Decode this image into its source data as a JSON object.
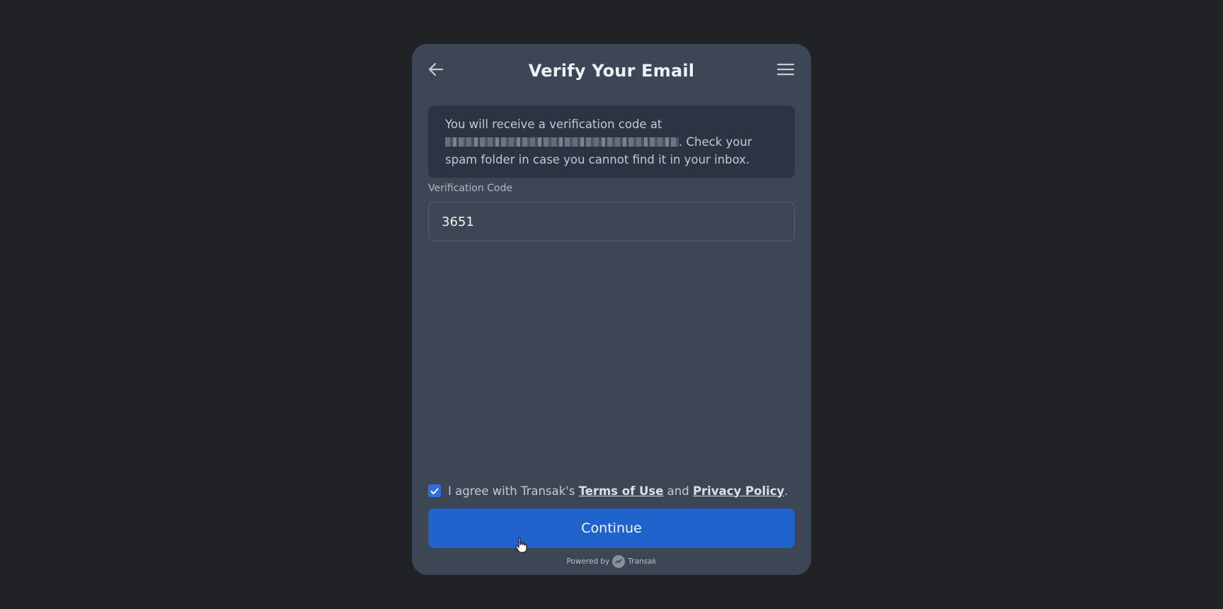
{
  "header": {
    "title": "Verify Your Email",
    "back_icon": "arrow-left-icon",
    "menu_icon": "hamburger-menu-icon"
  },
  "info": {
    "text_before": "You will receive a verification code at",
    "text_after": ". Check your spam folder in case you cannot find it in your inbox."
  },
  "verification": {
    "label": "Verification Code",
    "value": "3651"
  },
  "consent": {
    "checked": true,
    "prefix": "I agree with Transak's",
    "terms_label": "Terms of Use",
    "and": "and",
    "privacy_label": "Privacy Policy",
    "suffix": "."
  },
  "actions": {
    "continue_label": "Continue"
  },
  "footer": {
    "powered_by": "Powered by",
    "brand": "Transak"
  },
  "colors": {
    "background": "#212226",
    "panel": "#3d4655",
    "accent": "#2163cd"
  }
}
